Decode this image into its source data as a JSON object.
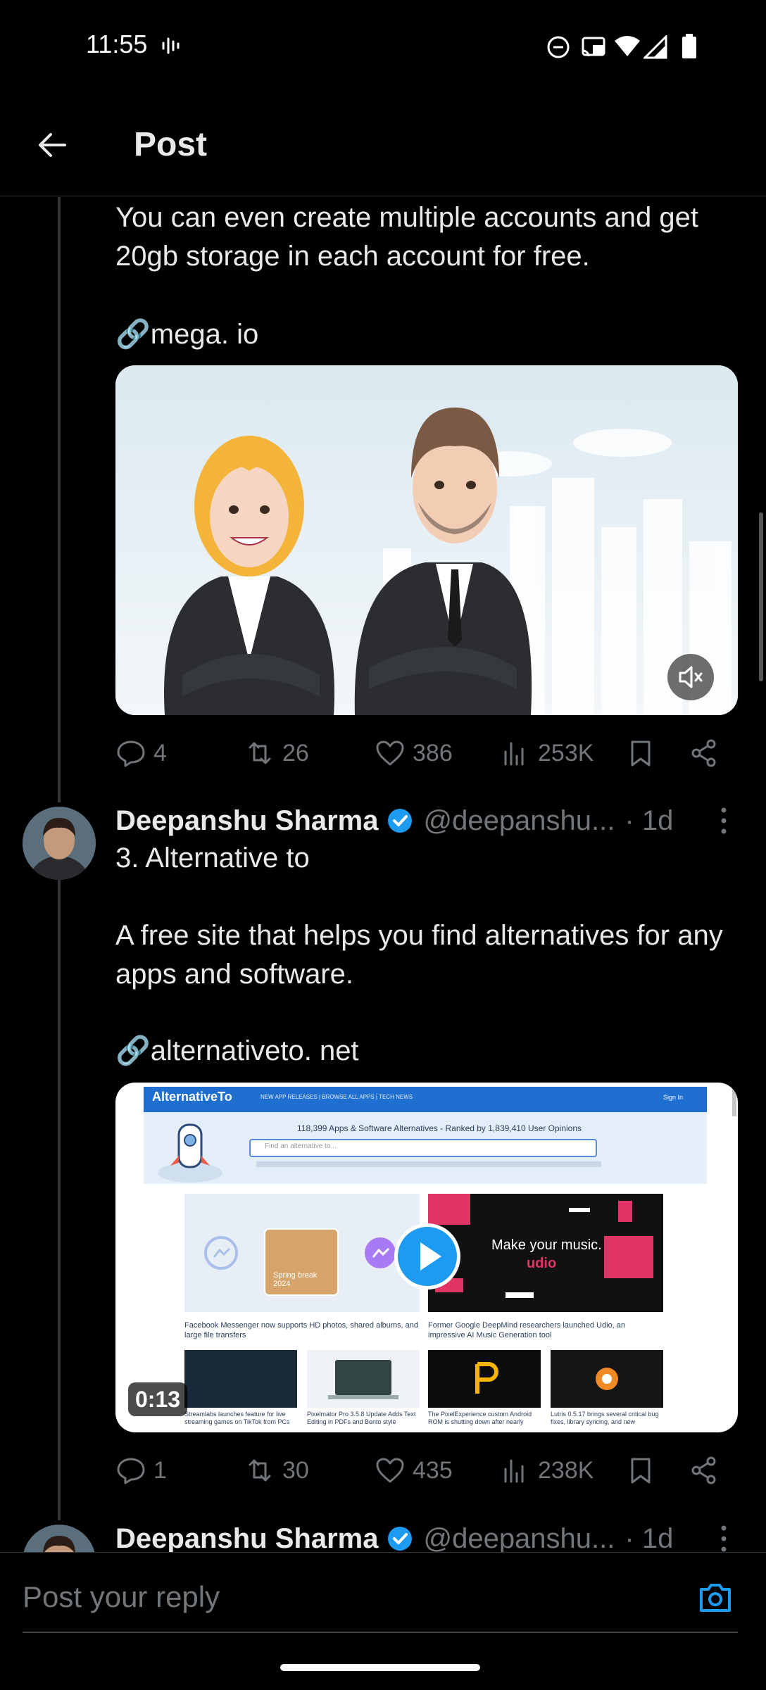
{
  "status_bar": {
    "time": "11:55"
  },
  "header": {
    "title": "Post"
  },
  "post1": {
    "text": "You can even create multiple accounts and get 20gb storage in each account for free.",
    "link": "🔗mega. io",
    "media_kind": "video",
    "stats": {
      "replies": "4",
      "reposts": "26",
      "likes": "386",
      "views": "253K"
    }
  },
  "post2": {
    "author": "Deepanshu Sharma",
    "handle": "@deepanshu...",
    "time": "· 1d",
    "title": "3. Alternative to",
    "text": "A free site that helps you find alternatives for any apps and software.",
    "link": "🔗alternativeto. net",
    "video_duration": "0:13",
    "preview": {
      "brand": "AlternativeTo",
      "nav": "NEW APP RELEASES | BROWSE ALL APPS | TECH NEWS",
      "sign_in": "Sign In",
      "count_line": "118,399 Apps & Software Alternatives - Ranked by 1,839,410 User Opinions",
      "search_placeholder": "Find an alternative to...",
      "card1_caption": "Facebook Messenger now supports HD photos, shared albums, and large file transfers",
      "card2_caption": "Former Google DeepMind researchers launched Udio, an impressive AI Music Generation tool",
      "card2_overlay": "Make your music.",
      "card2_brand": "udio",
      "spring_label": "Spring break 2024",
      "small1": "Streamlabs launches feature for live streaming games on TikTok from PCs",
      "small2": "Pixelmator Pro 3.5.8 Update Adds Text Editing in PDFs and Bento style",
      "small3": "The PixelExperience custom Android ROM is shutting down after nearly",
      "small4": "Lutris 0.5.17 brings several critical bug fixes, library syncing, and new"
    },
    "stats": {
      "replies": "1",
      "reposts": "30",
      "likes": "435",
      "views": "238K"
    }
  },
  "post3": {
    "author": "Deepanshu Sharma",
    "handle": "@deepanshu...",
    "time": "· 1d"
  },
  "reply": {
    "placeholder": "Post your reply"
  },
  "colors": {
    "accent": "#1d9bf0",
    "background": "#000000",
    "muted": "#71767b"
  }
}
